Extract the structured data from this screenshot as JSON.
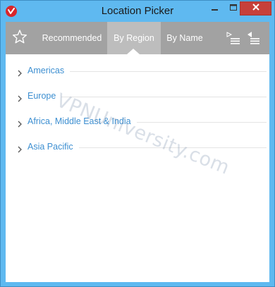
{
  "window": {
    "title": "Location Picker",
    "icons": {
      "logo": "vpn-logo-icon",
      "minimize": "minimize-icon",
      "maximize": "maximize-icon",
      "close": "close-icon"
    }
  },
  "tabs": {
    "favorites_icon": "star-icon",
    "items": [
      {
        "label": "Recommended",
        "selected": false
      },
      {
        "label": "By Region",
        "selected": true
      },
      {
        "label": "By Name",
        "selected": false
      }
    ],
    "expand_all_icon": "expand-all-icon",
    "collapse_all_icon": "collapse-all-icon"
  },
  "regions": [
    {
      "label": "Americas",
      "expanded": false
    },
    {
      "label": "Europe",
      "expanded": false
    },
    {
      "label": "Africa, Middle East & India",
      "expanded": false
    },
    {
      "label": "Asia Pacific",
      "expanded": false
    }
  ],
  "watermark": "VPNUniversity.com",
  "colors": {
    "titlebar": "#5fb9f0",
    "tabbar": "#a2a2a2",
    "tab_selected": "#bdbdbd",
    "region_text": "#3d8fd1",
    "close_button": "#c7403a"
  }
}
